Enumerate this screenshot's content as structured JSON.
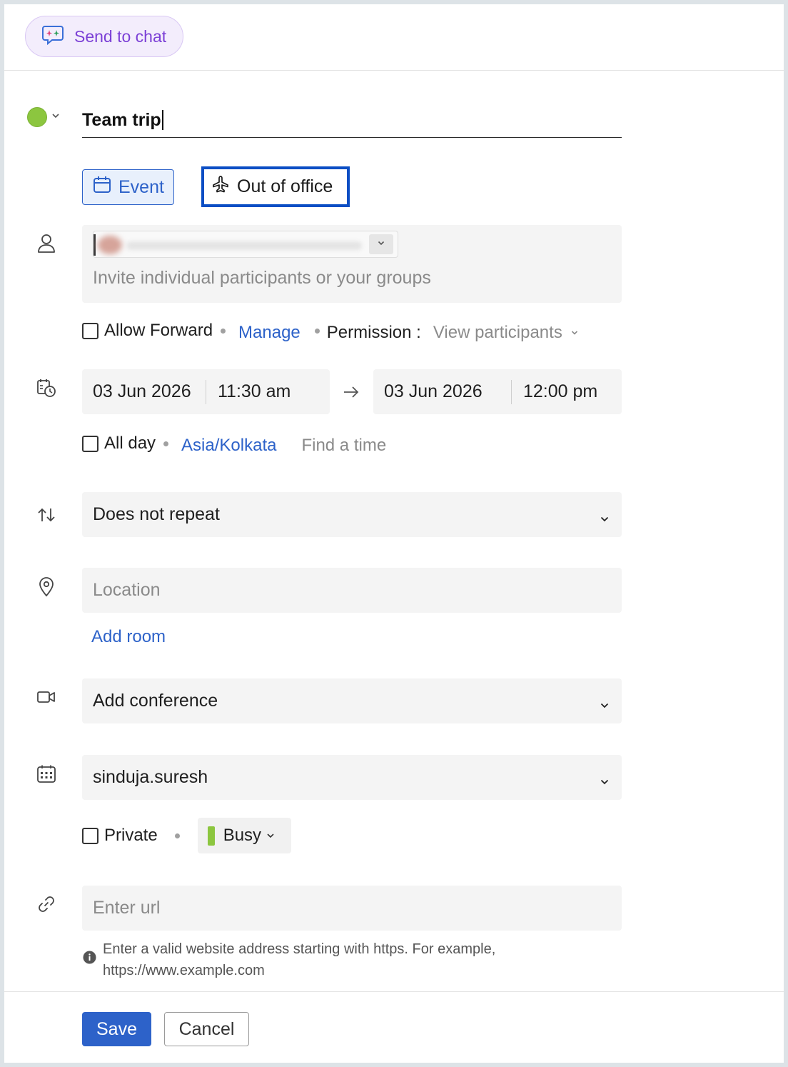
{
  "header": {
    "send_to_chat_label": "Send to chat"
  },
  "event": {
    "title": "Team trip",
    "color": "#8cc63f",
    "types": {
      "event_label": "Event",
      "ooo_label": "Out of office",
      "selected": "Out of office"
    }
  },
  "participants": {
    "placeholder": "Invite individual participants or your groups",
    "allow_forward_label": "Allow Forward",
    "manage_label": "Manage",
    "permission_label": "Permission :",
    "permission_value": "View participants"
  },
  "datetime": {
    "start_date": "03 Jun 2026",
    "start_time": "11:30 am",
    "end_date": "03 Jun 2026",
    "end_time": "12:00 pm",
    "all_day_label": "All day",
    "timezone": "Asia/Kolkata",
    "find_time_label": "Find a time"
  },
  "repeat": {
    "value": "Does not repeat"
  },
  "location": {
    "placeholder": "Location",
    "add_room_label": "Add room"
  },
  "conference": {
    "value": "Add conference"
  },
  "calendar": {
    "value": "sinduja.suresh",
    "private_label": "Private",
    "availability": "Busy",
    "availability_color": "#8cc63f"
  },
  "url": {
    "placeholder": "Enter url",
    "hint_line1": "Enter a valid website address starting with https. For example,",
    "hint_line2": "https://www.example.com"
  },
  "footer": {
    "save_label": "Save",
    "cancel_label": "Cancel"
  },
  "colors": {
    "accent": "#2d62c9",
    "chat_purple": "#7b3fd6",
    "selected_border": "#0b4ec4"
  }
}
